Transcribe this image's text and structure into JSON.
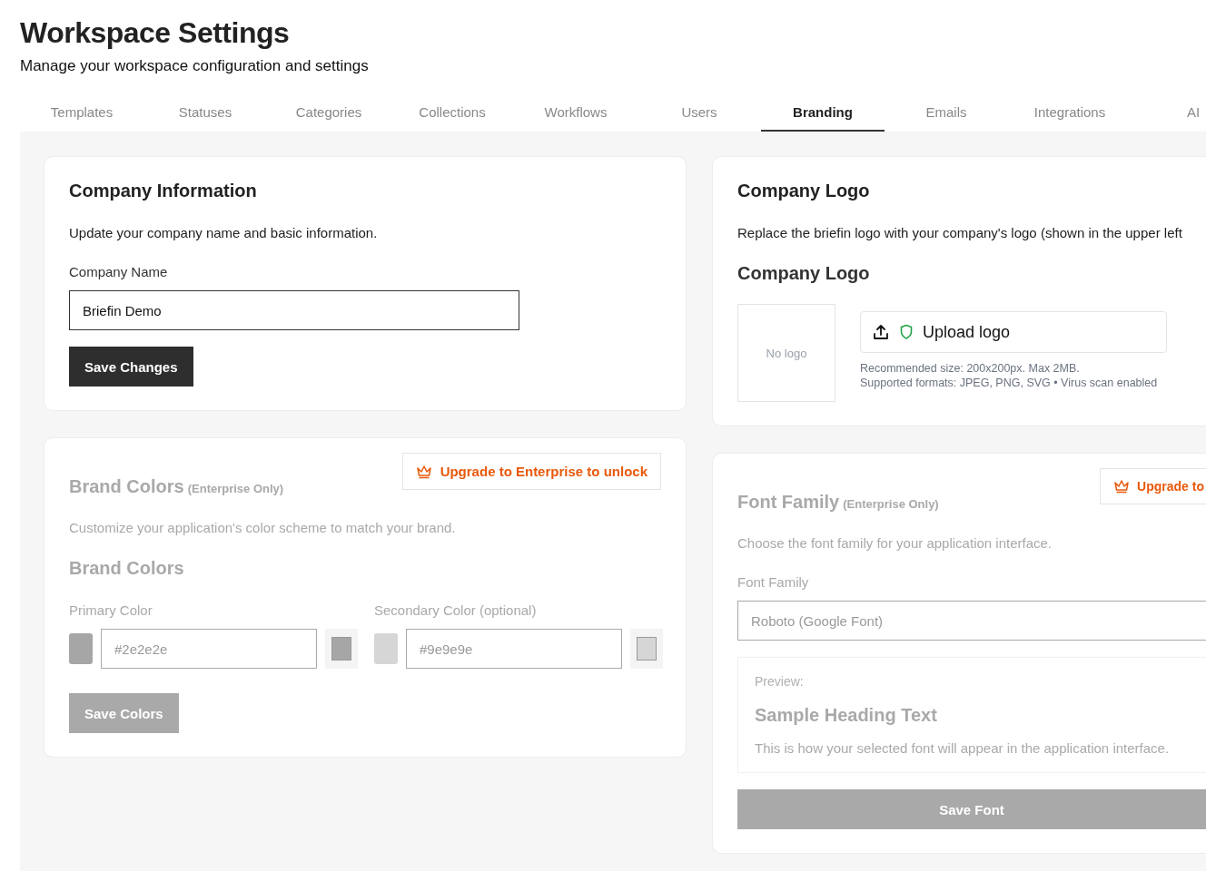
{
  "header": {
    "title": "Workspace Settings",
    "subtitle": "Manage your workspace configuration and settings"
  },
  "tabs": [
    {
      "label": "Templates",
      "selected": false
    },
    {
      "label": "Statuses",
      "selected": false
    },
    {
      "label": "Categories",
      "selected": false
    },
    {
      "label": "Collections",
      "selected": false
    },
    {
      "label": "Workflows",
      "selected": false
    },
    {
      "label": "Users",
      "selected": false
    },
    {
      "label": "Branding",
      "selected": true
    },
    {
      "label": "Emails",
      "selected": false
    },
    {
      "label": "Integrations",
      "selected": false
    },
    {
      "label": "AI",
      "selected": false
    }
  ],
  "company_info": {
    "title": "Company Information",
    "description": "Update your company name and basic information.",
    "field_label": "Company Name",
    "field_value": "Briefin Demo",
    "button": "Save Changes"
  },
  "brand_colors": {
    "title": "Brand Colors",
    "note": "(Enterprise Only)",
    "disabled": true,
    "upgrade_button": "Upgrade to Enterprise to unlock",
    "description": "Customize your application's color scheme to match your brand.",
    "subtitle": "Brand Colors",
    "colors": [
      {
        "label": "Primary Color",
        "value": "#2e2e2e",
        "color": "#a6a6a6"
      },
      {
        "label": "Secondary Color (optional)",
        "value": "#9e9e9e",
        "color": "#d6d6d6"
      }
    ],
    "button": "Save Colors"
  },
  "company_logo": {
    "title": "Company Logo",
    "description": "Replace the briefin logo with your company's logo (shown in the upper left",
    "subtitle": "Company Logo",
    "placeholder": "No logo",
    "upload_button": "Upload logo",
    "hints": [
      "Recommended size: 200x200px. Max 2MB.",
      "Supported formats: JPEG, PNG, SVG • Virus scan enabled"
    ]
  },
  "font_family": {
    "title": "Font Family",
    "note": "(Enterprise Only)",
    "disabled": true,
    "upgrade_button": "Upgrade to",
    "description": "Choose the font family for your application interface.",
    "field_label": "Font Family",
    "field_value": "Roboto (Google Font)",
    "preview": {
      "label": "Preview:",
      "heading": "Sample Heading Text",
      "text": "This is how your selected font will appear in the application interface."
    },
    "button": "Save Font"
  }
}
